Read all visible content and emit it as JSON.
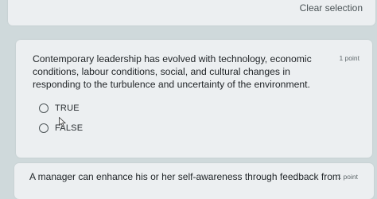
{
  "header": {
    "clear_selection": "Clear selection"
  },
  "question": {
    "text": "Contemporary leadership has evolved with technology, economic conditions, labour conditions, social, and cultural changes in responding to the turbulence and uncertainty of the environment.",
    "points": "1 point",
    "options": [
      {
        "label": "TRUE"
      },
      {
        "label": "FALSE"
      }
    ]
  },
  "next_question": {
    "text": "A manager can enhance his or her self-awareness through feedback from",
    "points": "1 point"
  },
  "icons": {
    "cursor": "mouse-pointer-icon"
  }
}
